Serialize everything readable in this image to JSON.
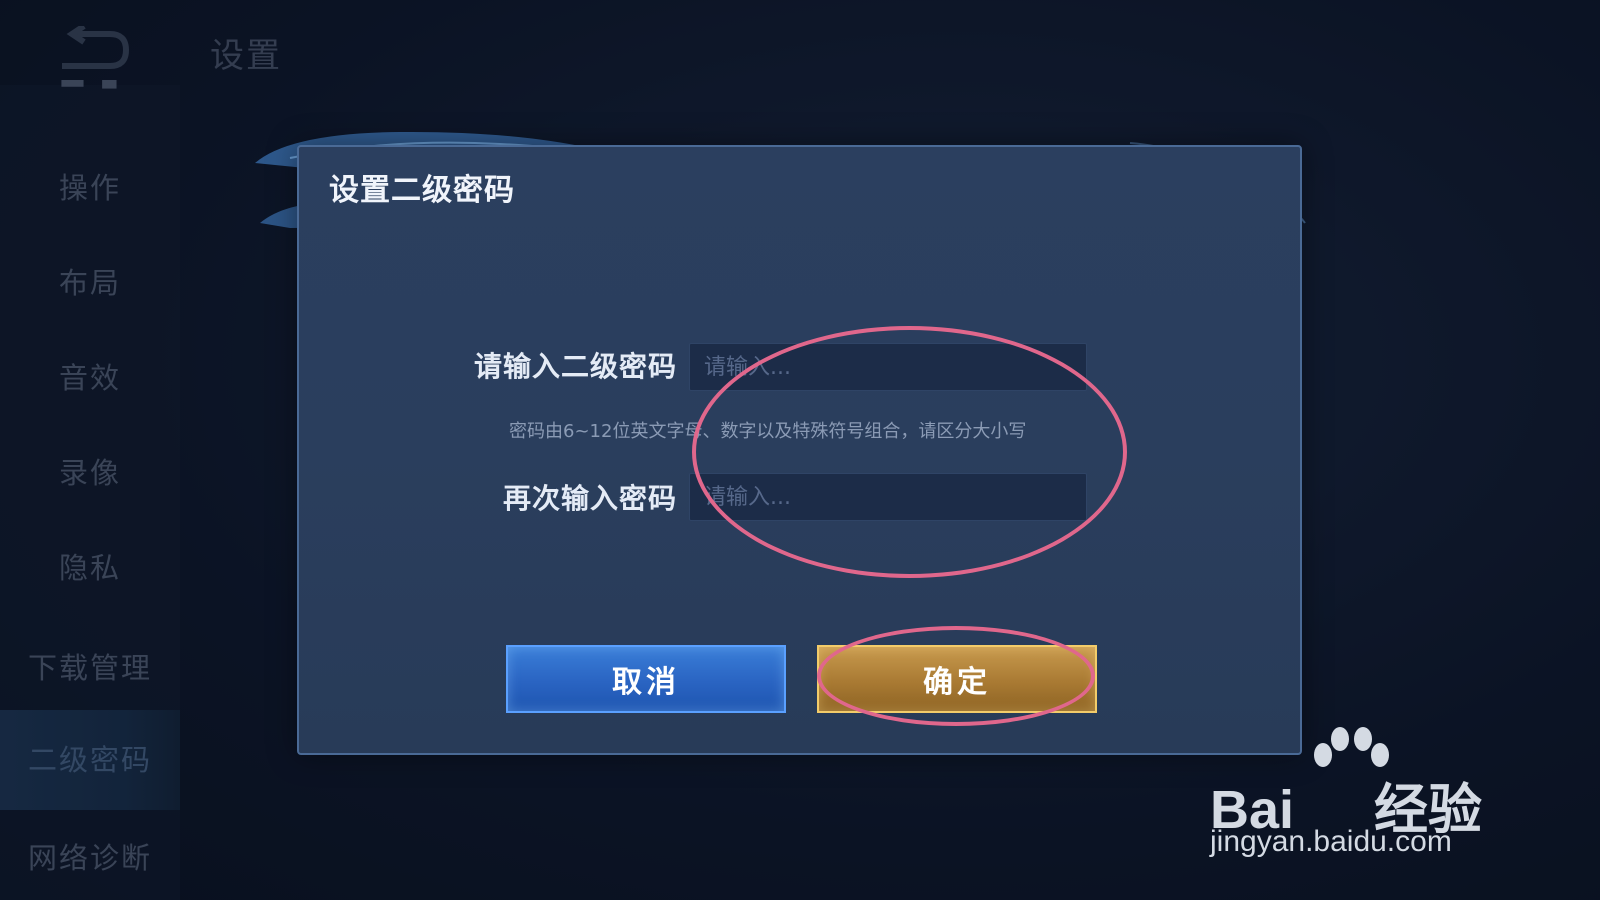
{
  "header": {
    "title": "设置"
  },
  "sidebar": {
    "items": [
      {
        "label": "操作"
      },
      {
        "label": "布局"
      },
      {
        "label": "音效"
      },
      {
        "label": "录像"
      },
      {
        "label": "隐私"
      },
      {
        "label": "下载管理"
      },
      {
        "label": "二级密码",
        "active": true
      },
      {
        "label": "网络诊断"
      }
    ]
  },
  "dialog": {
    "title": "设置二级密码",
    "password_label": "请输入二级密码",
    "password_placeholder": "请输入...",
    "hint": "密码由6~12位英文字母、数字以及特殊符号组合，请区分大小写",
    "confirm_label": "再次输入密码",
    "confirm_placeholder": "请输入...",
    "cancel_button": "取消",
    "ok_button": "确定"
  },
  "colors": {
    "cancel": "#2a64c2",
    "ok": "#a97a33",
    "annotation": "#e0678c"
  },
  "watermark": {
    "url": "jingyan.baidu.com"
  }
}
